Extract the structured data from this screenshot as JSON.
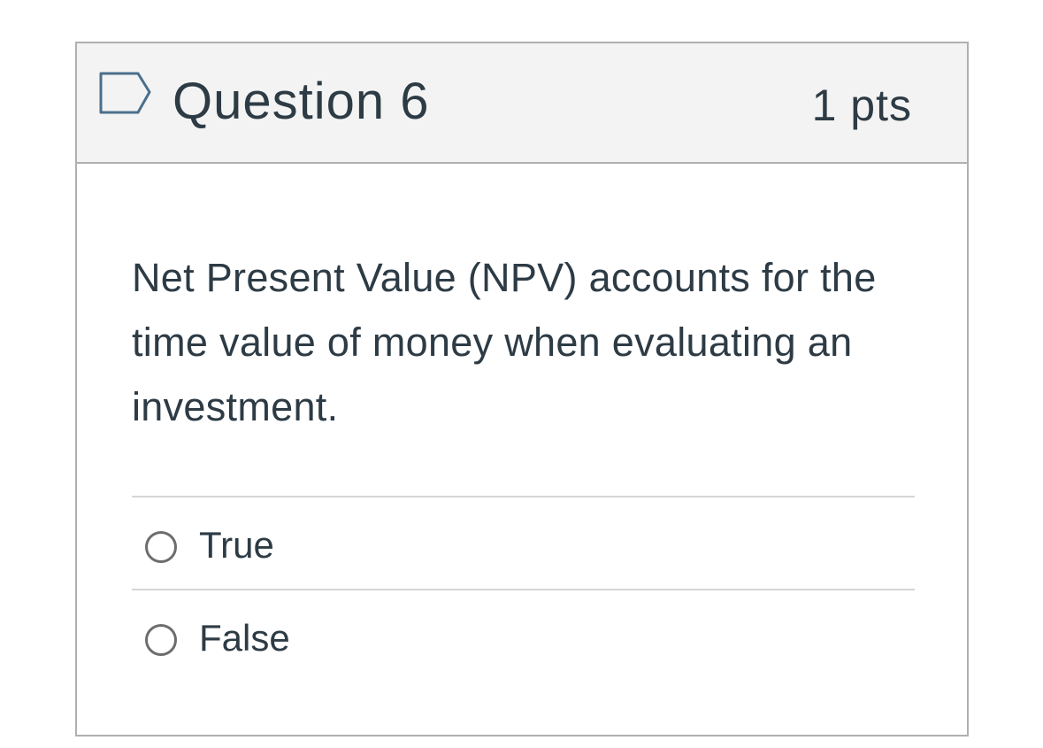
{
  "question": {
    "title": "Question 6",
    "points": "1 pts",
    "text": "Net Present Value (NPV) accounts for the time value of money when evaluating an investment."
  },
  "answers": [
    {
      "label": "True",
      "selected": false
    },
    {
      "label": "False",
      "selected": false
    }
  ],
  "icons": {
    "flag": "flag-outline-icon"
  },
  "colors": {
    "text": "#2d3b45",
    "header_bg": "#f3f3f3",
    "border": "#b0b0b0",
    "flag_stroke": "#4a6f8c"
  }
}
